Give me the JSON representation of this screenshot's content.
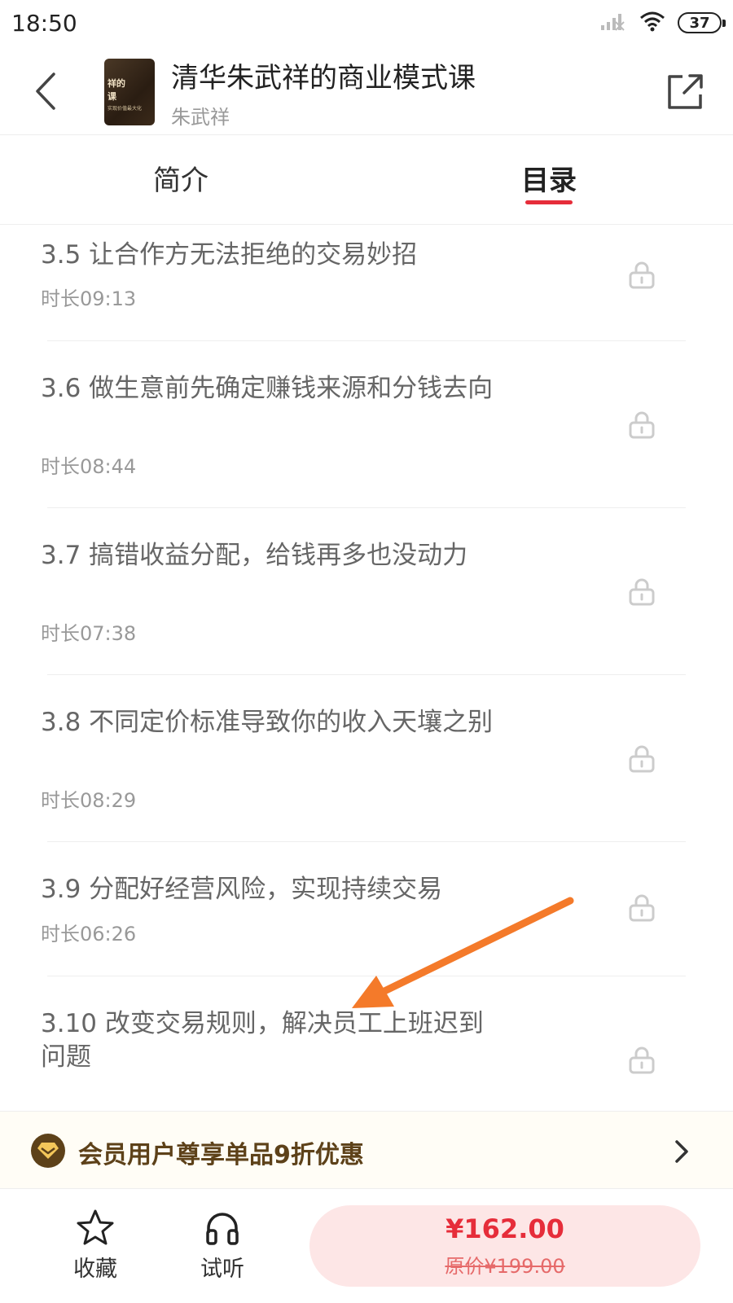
{
  "status_bar": {
    "time": "18:50",
    "battery": "37"
  },
  "header": {
    "title": "清华朱武祥的商业模式课",
    "author": "朱武祥",
    "cover_line1": "祥的",
    "cover_line2": "课",
    "cover_sub": "实现价值最大化"
  },
  "tabs": [
    {
      "label": "简介",
      "active": false
    },
    {
      "label": "目录",
      "active": true
    }
  ],
  "lessons": [
    {
      "title": "3.5 让合作方无法拒绝的交易妙招",
      "duration": "时长09:13",
      "locked": true
    },
    {
      "title": "3.6 做生意前先确定赚钱来源和分钱去向",
      "duration": "时长08:44",
      "locked": true
    },
    {
      "title": "3.7 搞错收益分配，给钱再多也没动力",
      "duration": "时长07:38",
      "locked": true
    },
    {
      "title": "3.8 不同定价标准导致你的收入天壤之别",
      "duration": "时长08:29",
      "locked": true
    },
    {
      "title": "3.9 分配好经营风险，实现持续交易",
      "duration": "时长06:26",
      "locked": true
    },
    {
      "title": "3.10 改变交易规则，解决员工上班迟到问题",
      "duration": "",
      "locked": true
    }
  ],
  "member_bar": {
    "text": "会员用户尊享单品9折优惠"
  },
  "bottom_bar": {
    "favorite_label": "收藏",
    "listen_label": "试听",
    "price": "¥162.00",
    "original_price": "原价¥199.00"
  },
  "colors": {
    "accent": "#e62d3a",
    "member_brown": "#5d4119",
    "buy_bg": "#fde6e6",
    "annotation_arrow": "#f47a2a"
  }
}
